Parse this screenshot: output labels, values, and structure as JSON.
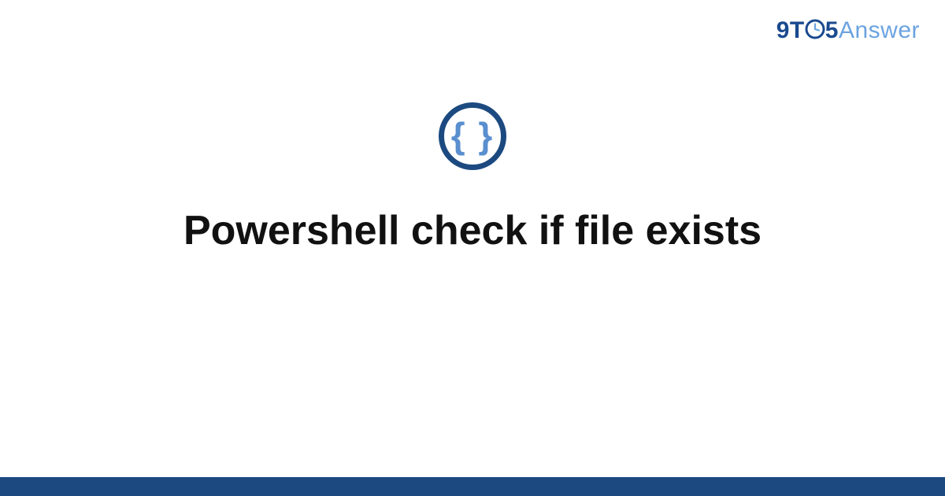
{
  "brand": {
    "part1": "9T",
    "part2": "5",
    "part3": "Answer"
  },
  "badge": {
    "glyph": "{ }"
  },
  "title": "Powershell check if file exists",
  "colors": {
    "brand_dark": "#1a4a8f",
    "brand_light": "#6ba3e0",
    "badge_ring": "#1c4a80",
    "badge_braces": "#5a8fcf",
    "footer": "#1c4a80"
  }
}
